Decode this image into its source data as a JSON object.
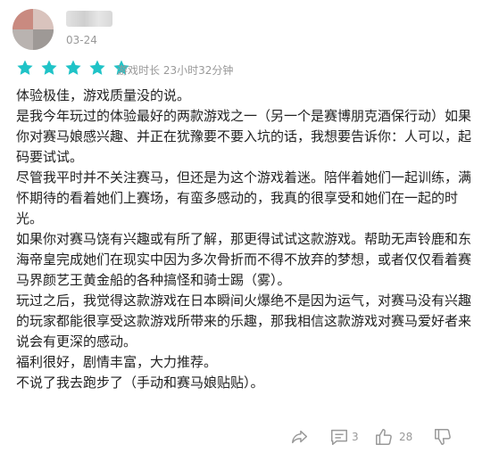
{
  "review": {
    "date": "03-24",
    "rating": 5,
    "play_time": "游戏时长 23小时32分钟",
    "paragraphs": [
      "体验极佳，游戏质量没的说。",
      "是我今年玩过的体验最好的两款游戏之一（另一个是赛博朋克酒保行动）如果你对赛马娘感兴趣、并正在犹豫要不要入坑的话，我想要告诉你：人可以，起码要试试。",
      "尽管我平时并不关注赛马，但还是为这个游戏着迷。陪伴着她们一起训练，满怀期待的看着她们上赛场，有蛮多感动的，我真的很享受和她们在一起的时光。",
      "如果你对赛马饶有兴趣或有所了解，那更得试试这款游戏。帮助无声铃鹿和东海帝皇完成她们在现实中因为多次骨折而不得不放弃的梦想，或者仅仅看着赛马界颜艺王黄金船的各种搞怪和骑士踢（雾）。",
      "玩过之后，我觉得这款游戏在日本瞬间火爆绝不是因为运气，对赛马没有兴趣的玩家都能很享受这款游戏所带来的乐趣，那我相信这款游戏对赛马爱好者来说会有更深的感动。",
      "福利很好，剧情丰富，大力推荐。",
      "不说了我去跑步了（手动和赛马娘贴贴）。"
    ]
  },
  "actions": {
    "comment_count": "3",
    "like_count": "28"
  },
  "colors": {
    "star": "#1fc3c7",
    "muted": "#999999",
    "text": "#222222"
  },
  "icons": [
    "share-icon",
    "comment-icon",
    "thumbs-up-icon",
    "thumbs-down-icon",
    "star-icon"
  ]
}
